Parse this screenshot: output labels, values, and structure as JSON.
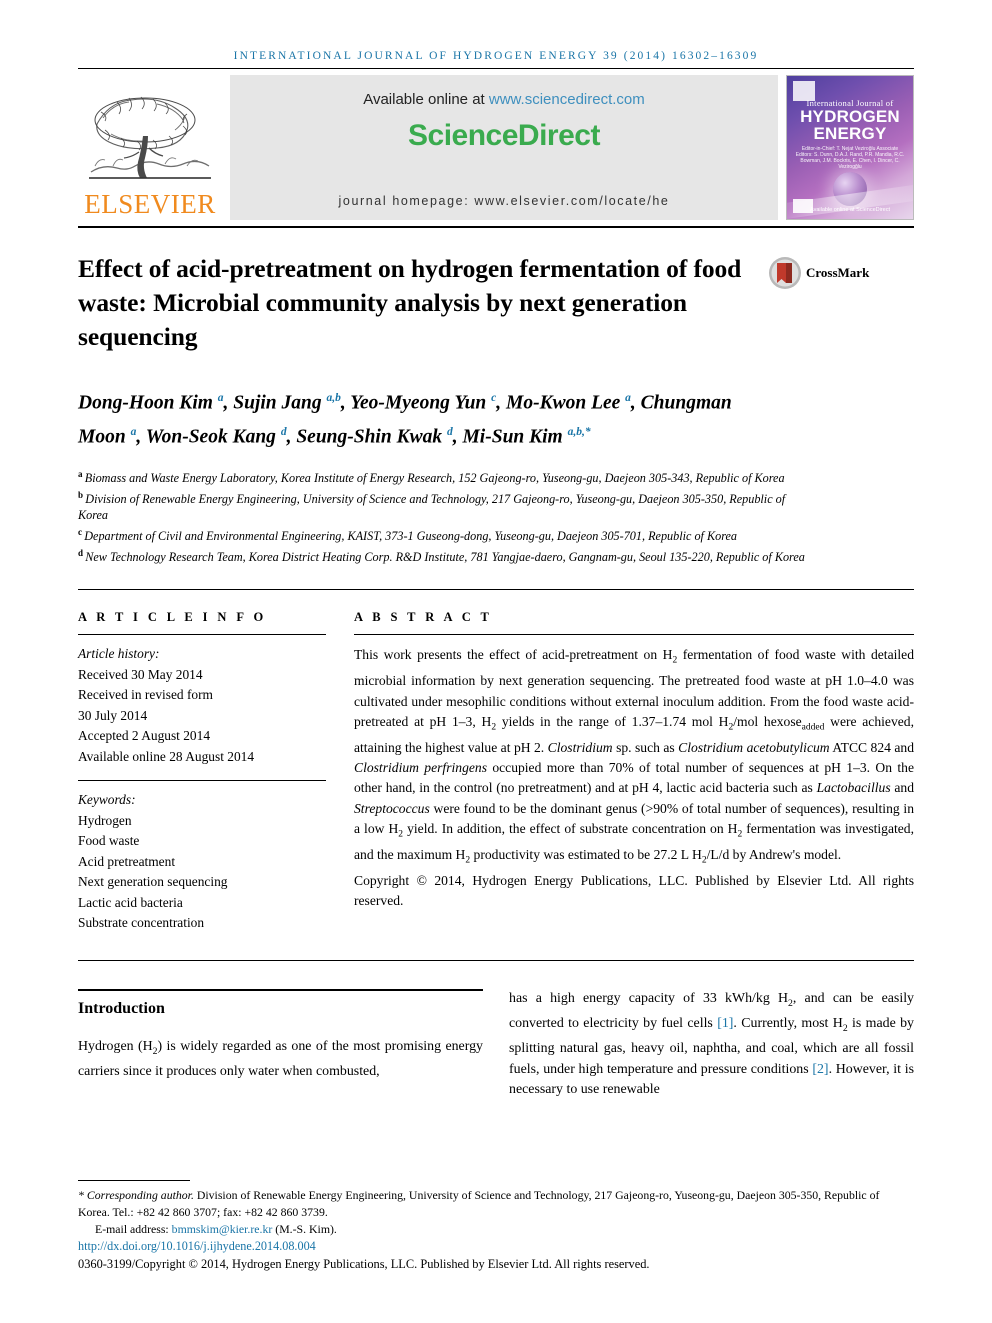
{
  "running_head": "International Journal of Hydrogen Energy 39 (2014) 16302–16309",
  "masthead": {
    "publisher_name": "ELSEVIER",
    "available_prefix": "Available online at ",
    "available_url": "www.sciencedirect.com",
    "sciencedirect_logo": "ScienceDirect",
    "journal_homepage": "journal homepage: www.elsevier.com/locate/he",
    "cover": {
      "line_small": "International Journal of",
      "line_big_1": "HYDROGEN",
      "line_big_2": "ENERGY",
      "editors": "Editor-in-Chief: T. Nejat Veziroğlu   Associate Editors: S. Dunn, D.A.J. Rand, P.R. Mandia, R.C. Bowman, J.M. Bockris, E. Chen, I. Dincer, C. Vezirogğlu",
      "footer": "Available online at ScienceDirect"
    },
    "colors": {
      "elsevier_orange": "#f08a1e",
      "sciencedirect_green": "#3aab4e",
      "link_blue": "#3e8fbe",
      "panel_grey": "#e6e6e6"
    }
  },
  "crossmark": {
    "label": "CrossMark"
  },
  "title": "Effect of acid-pretreatment on hydrogen fermentation of food waste: Microbial community analysis by next generation sequencing",
  "authors": [
    {
      "name": "Dong-Hoon Kim",
      "marks": "a",
      "sep": ", "
    },
    {
      "name": "Sujin Jang",
      "marks": "a,b",
      "sep": ", "
    },
    {
      "name": "Yeo-Myeong Yun",
      "marks": "c",
      "sep": ", "
    },
    {
      "name": "Mo-Kwon Lee",
      "marks": "a",
      "sep": ", "
    },
    {
      "name": "Chungman Moon",
      "marks": "a",
      "sep": ", "
    },
    {
      "name": "Won-Seok Kang",
      "marks": "d",
      "sep": ", "
    },
    {
      "name": "Seung-Shin Kwak",
      "marks": "d",
      "sep": ", "
    },
    {
      "name": "Mi-Sun Kim",
      "marks": "a,b,*",
      "sep": ""
    }
  ],
  "affiliations": [
    {
      "mark": "a",
      "text": "Biomass and Waste Energy Laboratory, Korea Institute of Energy Research, 152 Gajeong-ro, Yuseong-gu, Daejeon 305-343, Republic of Korea"
    },
    {
      "mark": "b",
      "text": "Division of Renewable Energy Engineering, University of Science and Technology, 217 Gajeong-ro, Yuseong-gu, Daejeon 305-350, Republic of Korea"
    },
    {
      "mark": "c",
      "text": "Department of Civil and Environmental Engineering, KAIST, 373-1 Guseong-dong, Yuseong-gu, Daejeon 305-701, Republic of Korea"
    },
    {
      "mark": "d",
      "text": "New Technology Research Team, Korea District Heating Corp. R&D Institute, 781 Yangjae-daero, Gangnam-gu, Seoul 135-220, Republic of Korea"
    }
  ],
  "article_info": {
    "heading": "ARTICLE INFO",
    "history_label": "Article history:",
    "history": [
      "Received 30 May 2014",
      "Received in revised form",
      "30 July 2014",
      "Accepted 2 August 2014",
      "Available online 28 August 2014"
    ],
    "keywords_label": "Keywords:",
    "keywords": [
      "Hydrogen",
      "Food waste",
      "Acid pretreatment",
      "Next generation sequencing",
      "Lactic acid bacteria",
      "Substrate concentration"
    ]
  },
  "abstract": {
    "heading": "ABSTRACT",
    "paragraph_html": "This work presents the effect of acid-pretreatment on H<sub>2</sub> fermentation of food waste with detailed microbial information by next generation sequencing. The pretreated food waste at pH 1.0–4.0 was cultivated under mesophilic conditions without external inoculum addition. From the food waste acid-pretreated at pH 1–3, H<sub>2</sub> yields in the range of 1.37–1.74 mol H<sub>2</sub>/mol hexose<sub>added</sub> were achieved, attaining the highest value at pH 2. <i>Clostridium</i> sp. such as <i>Clostridium acetobutylicum</i> ATCC 824 and <i>Clostridium perfringens</i> occupied more than 70% of total number of sequences at pH 1–3. On the other hand, in the control (no pretreatment) and at pH 4, lactic acid bacteria such as <i>Lactobacillus</i> and <i>Streptococcus</i> were found to be the dominant genus (&gt;90% of total number of sequences), resulting in a low H<sub>2</sub> yield. In addition, the effect of substrate concentration on H<sub>2</sub> fermentation was investigated, and the maximum H<sub>2</sub> productivity was estimated to be 27.2 L H<sub>2</sub>/L/d by Andrew's model.",
    "copyright": "Copyright © 2014, Hydrogen Energy Publications, LLC. Published by Elsevier Ltd. All rights reserved."
  },
  "introduction": {
    "heading": "Introduction",
    "left_html": "Hydrogen (H<sub>2</sub>) is widely regarded as one of the most promising energy carriers since it produces only water when combusted,",
    "right_html": "has a high energy capacity of 33 kWh/kg H<sub>2</sub>, and can be easily converted to electricity by fuel cells <span class=\"ref\">[1]</span>. Currently, most H<sub>2</sub> is made by splitting natural gas, heavy oil, naphtha, and coal, which are all fossil fuels, under high temperature and pressure conditions <span class=\"ref\">[2]</span>. However, it is necessary to use renewable"
  },
  "footnotes": {
    "corresponding_html": "<span class=\"ital\">* Corresponding author.</span> Division of Renewable Energy Engineering, University of Science and Technology, 217 Gajeong-ro, Yuseong-gu, Daejeon 305-350, Republic of Korea. Tel.: +82 42 860 3707; fax: +82 42 860 3739.",
    "email_label": "E-mail address:",
    "email": "bmmskim@kier.re.kr",
    "email_suffix": "(M.-S. Kim).",
    "doi": "http://dx.doi.org/10.1016/j.ijhydene.2014.08.004",
    "issn_line": "0360-3199/Copyright © 2014, Hydrogen Energy Publications, LLC. Published by Elsevier Ltd. All rights reserved."
  }
}
